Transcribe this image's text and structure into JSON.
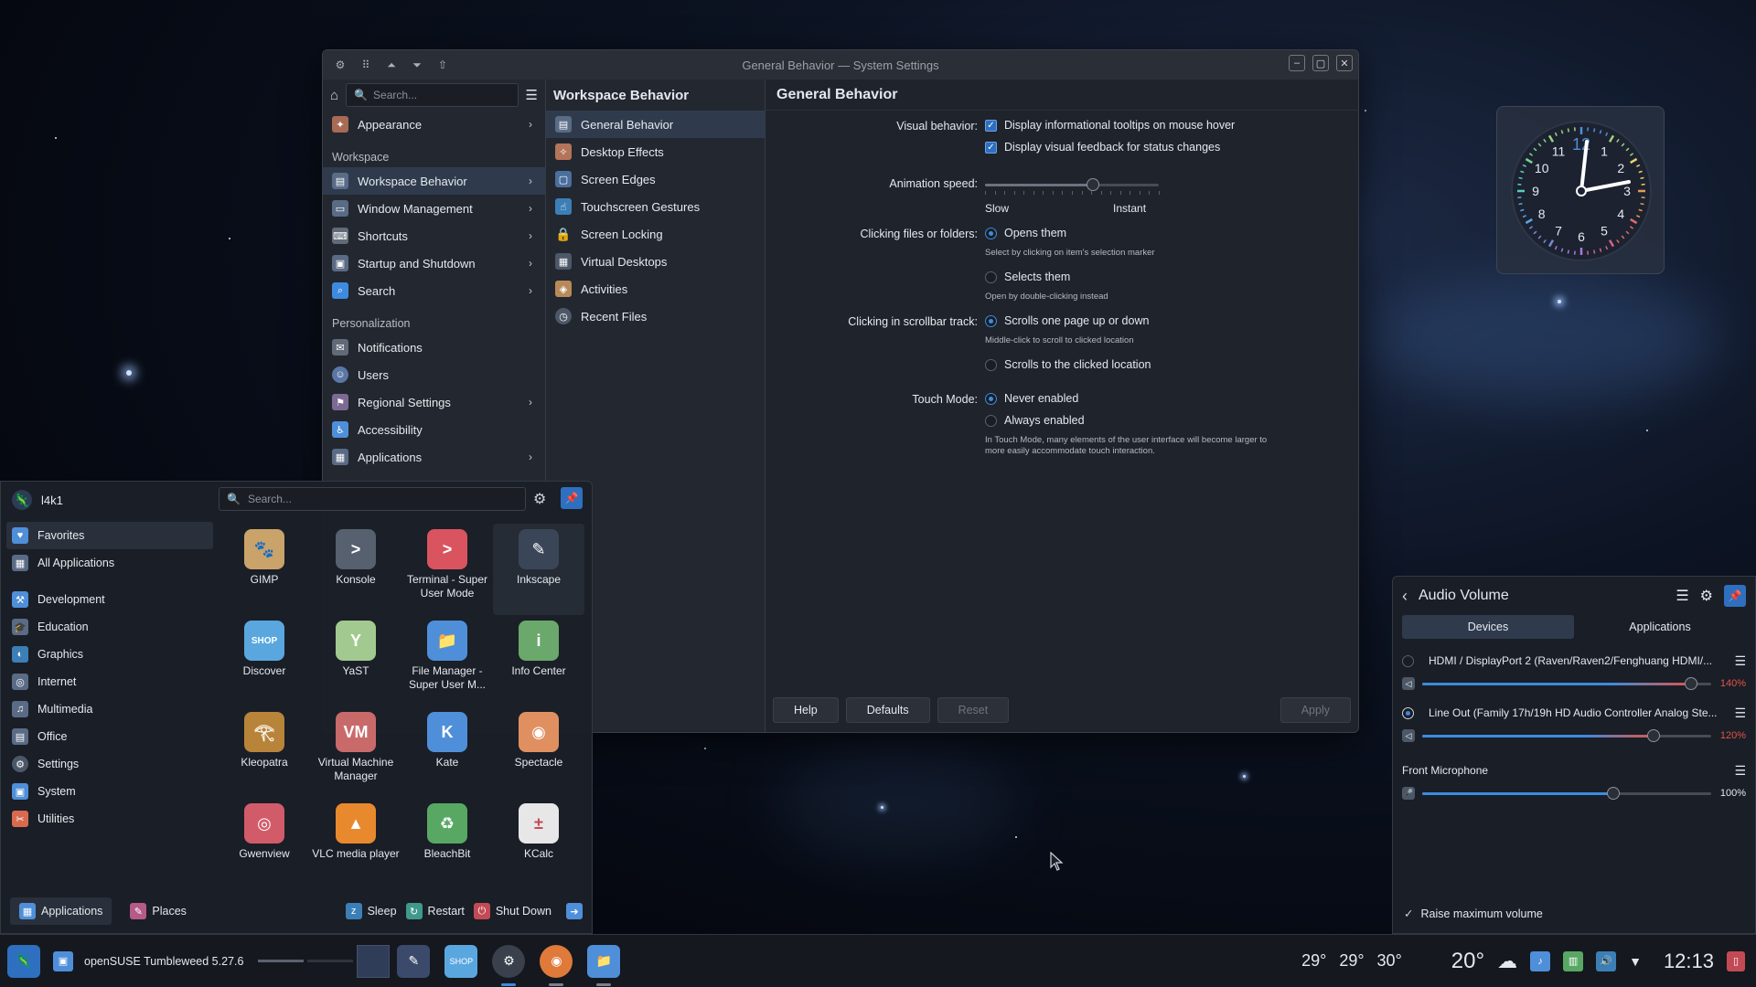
{
  "window": {
    "title": "General Behavior — System Settings",
    "search_placeholder": "Search...",
    "col1": {
      "top_item": "Appearance",
      "sections": [
        {
          "title": "Workspace",
          "items": [
            "Workspace Behavior",
            "Window Management",
            "Shortcuts",
            "Startup and Shutdown",
            "Search"
          ]
        },
        {
          "title": "Personalization",
          "items": [
            "Notifications",
            "Users",
            "Regional Settings",
            "Accessibility",
            "Applications"
          ]
        }
      ]
    },
    "col2": {
      "title": "Workspace Behavior",
      "items": [
        "General Behavior",
        "Desktop Effects",
        "Screen Edges",
        "Touchscreen Gestures",
        "Screen Locking",
        "Virtual Desktops",
        "Activities",
        "Recent Files"
      ]
    },
    "page": {
      "title": "General Behavior",
      "visual_label": "Visual behavior:",
      "visual_opt1": "Display informational tooltips on mouse hover",
      "visual_opt2": "Display visual feedback for status changes",
      "anim_label": "Animation speed:",
      "anim_slow": "Slow",
      "anim_instant": "Instant",
      "anim_value": 0.62,
      "click_label": "Clicking files or folders:",
      "click_opt1": "Opens them",
      "click_hint1": "Select by clicking on item's selection marker",
      "click_opt2": "Selects them",
      "click_hint2": "Open by double-clicking instead",
      "scroll_label": "Clicking in scrollbar track:",
      "scroll_opt1": "Scrolls one page up or down",
      "scroll_hint1": "Middle-click to scroll to clicked location",
      "scroll_opt2": "Scrolls to the clicked location",
      "touch_label": "Touch Mode:",
      "touch_opt1": "Never enabled",
      "touch_opt2": "Always enabled",
      "touch_hint_line1": "In Touch Mode, many elements of the user interface will become larger to",
      "touch_hint_line2": "more easily accommodate touch interaction."
    },
    "footer": {
      "help": "Help",
      "defaults": "Defaults",
      "reset": "Reset",
      "apply": "Apply"
    }
  },
  "clock": {
    "numbers": [
      "12",
      "1",
      "2",
      "3",
      "4",
      "5",
      "6",
      "7",
      "8",
      "9",
      "10",
      "11"
    ],
    "time": "12:13"
  },
  "launcher": {
    "user": "l4k1",
    "search_placeholder": "Search...",
    "categories": [
      "Favorites",
      "All Applications",
      "Development",
      "Education",
      "Graphics",
      "Internet",
      "Multimedia",
      "Office",
      "Settings",
      "System",
      "Utilities"
    ],
    "apps": [
      {
        "name": "GIMP",
        "color": "#c9a36a",
        "glyph": "🐾"
      },
      {
        "name": "Konsole",
        "color": "#56606e",
        "glyph": ">"
      },
      {
        "name": "Terminal - Super User Mode",
        "color": "#d9545f",
        "glyph": ">"
      },
      {
        "name": "Inkscape",
        "color": "#3a4658",
        "glyph": "✎"
      },
      {
        "name": "Discover",
        "color": "#5aa7e0",
        "glyph": "SHOP"
      },
      {
        "name": "YaST",
        "color": "#a2c98f",
        "glyph": "Y"
      },
      {
        "name": "File Manager - Super User M...",
        "color": "#4f8fd9",
        "glyph": "📁"
      },
      {
        "name": "Info Center",
        "color": "#6aa86b",
        "glyph": "i"
      },
      {
        "name": "Kleopatra",
        "color": "#b8843a",
        "glyph": "𓂀"
      },
      {
        "name": "Virtual Machine Manager",
        "color": "#c96a6a",
        "glyph": "VM"
      },
      {
        "name": "Kate",
        "color": "#4f8fd9",
        "glyph": "K"
      },
      {
        "name": "Spectacle",
        "color": "#e09060",
        "glyph": "◉"
      },
      {
        "name": "Gwenview",
        "color": "#d25b6a",
        "glyph": "◎"
      },
      {
        "name": "VLC media player",
        "color": "#e8892e",
        "glyph": "▲"
      },
      {
        "name": "BleachBit",
        "color": "#58a864",
        "glyph": "♻"
      },
      {
        "name": "KCalc",
        "color": "#e7e7e7",
        "glyph": "±"
      }
    ],
    "footer": {
      "applications": "Applications",
      "places": "Places",
      "sleep": "Sleep",
      "restart": "Restart",
      "shutdown": "Shut Down"
    }
  },
  "audio": {
    "title": "Audio Volume",
    "tab_devices": "Devices",
    "tab_applications": "Applications",
    "devices": [
      {
        "name": "HDMI / DisplayPort 2 (Raven/Raven2/Fenghuang HDMI/...",
        "percent": "140%",
        "value": 0.93,
        "over": true
      },
      {
        "name": "Line Out (Family 17h/19h HD Audio Controller Analog Ste...",
        "percent": "120%",
        "value": 0.8,
        "over": true
      },
      {
        "name": "Front Microphone",
        "percent": "100%",
        "value": 0.66,
        "over": false
      }
    ],
    "raise_max": "Raise maximum volume"
  },
  "taskbar": {
    "task_title": "openSUSE Tumbleweed 5.27.6",
    "temps": [
      "29°",
      "29°",
      "30°"
    ],
    "weather": "20°",
    "time": "12:13"
  },
  "colors": {
    "accent": "#3d8be0",
    "over_volume": "#e0544a"
  }
}
